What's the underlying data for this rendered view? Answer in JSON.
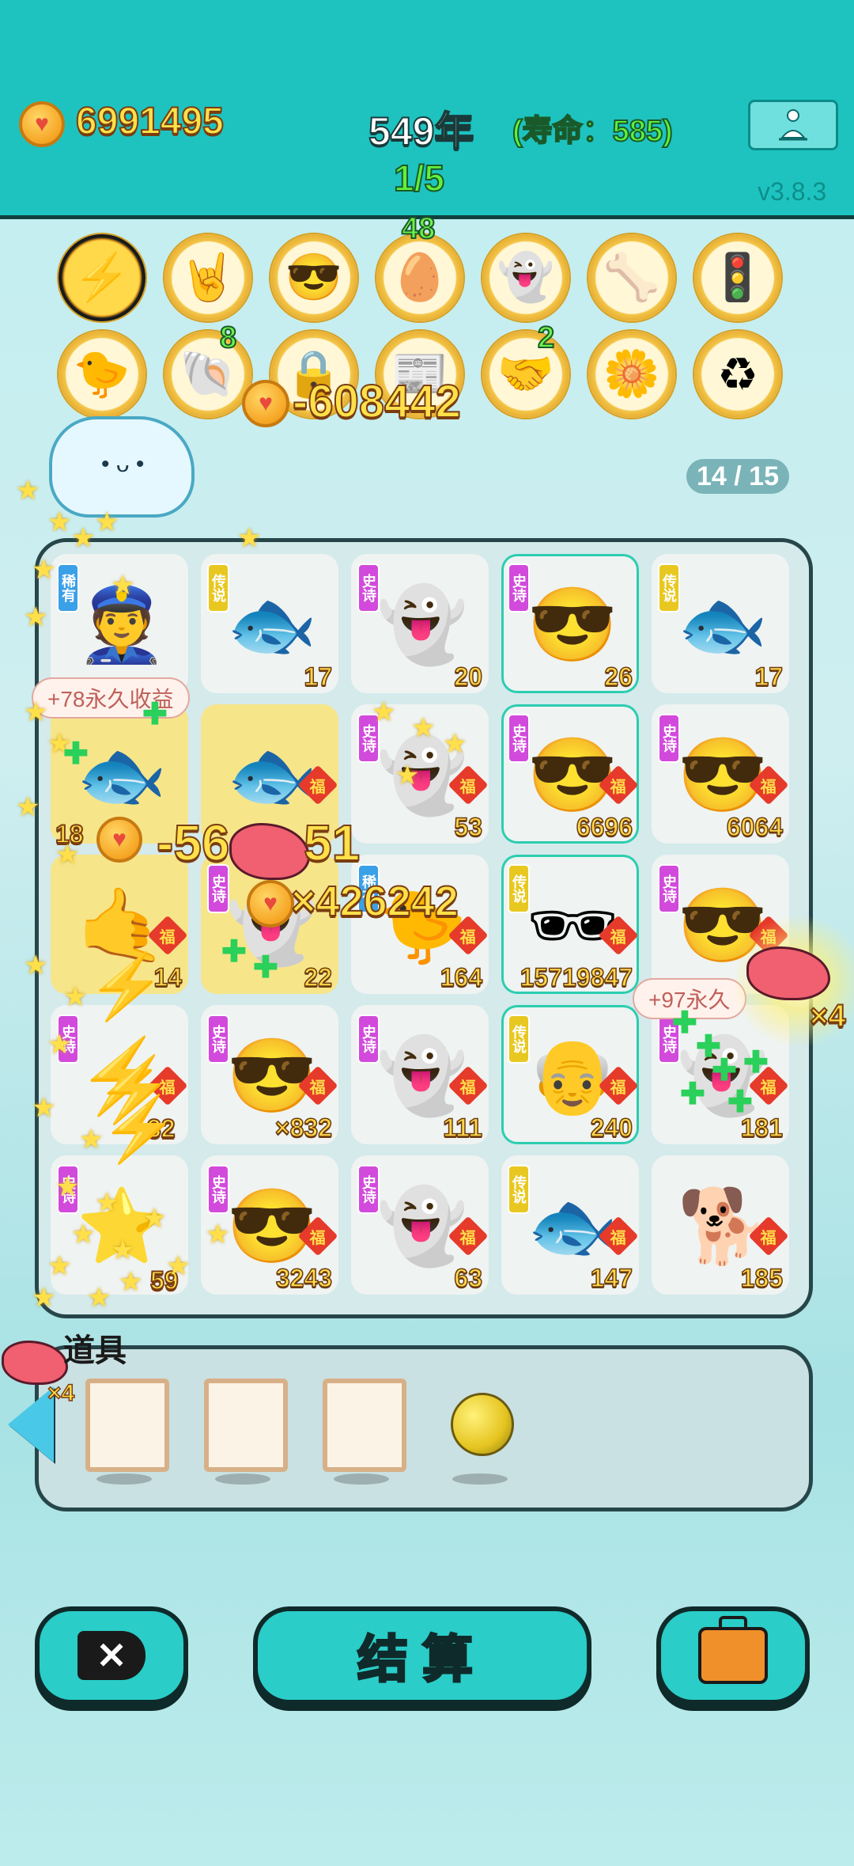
{
  "header": {
    "coins": "6991495",
    "year": "549年",
    "lifespan": "(寿命：585)",
    "round": "1/5",
    "version": "v3.8.3"
  },
  "badges": {
    "row1": [
      {
        "icon": "lightning-icon",
        "glyph": "⚡",
        "count": ""
      },
      {
        "icon": "rock-hand-icon",
        "glyph": "🤘",
        "count": ""
      },
      {
        "icon": "crowd-face-icon",
        "glyph": "😎",
        "count": ""
      },
      {
        "icon": "egg-tray-icon",
        "glyph": "🥚",
        "count": "48"
      },
      {
        "icon": "ghost-icon",
        "glyph": "👻",
        "count": ""
      },
      {
        "icon": "dog-bowl-icon",
        "glyph": "🦴",
        "count": ""
      },
      {
        "icon": "traffic-light-icon",
        "glyph": "🚦",
        "count": ""
      }
    ],
    "row2": [
      {
        "icon": "chick-icon",
        "glyph": "🐤",
        "count": ""
      },
      {
        "icon": "shell-icon",
        "glyph": "🐚",
        "count": "8"
      },
      {
        "icon": "safe-icon",
        "glyph": "🔒",
        "count": ""
      },
      {
        "icon": "time-magazine-icon",
        "glyph": "📰",
        "count": ""
      },
      {
        "icon": "handshake-icon",
        "glyph": "🤝",
        "count": "2"
      },
      {
        "icon": "flower-pot-icon",
        "glyph": "🌼",
        "count": ""
      },
      {
        "icon": "recycle-icon",
        "glyph": "♻",
        "count": ""
      }
    ]
  },
  "fx": {
    "coin_delta": "-608442",
    "multiplier": "×426242",
    "perm_gain_left": "+78永久收益",
    "perm_gain_right": "+97永久",
    "side_mult": "×4",
    "big_neg": "-56",
    "big_neg_tail": "51",
    "row3_left_val": "18",
    "row4_left_val": "32",
    "row5_left_val": "59"
  },
  "page_indicator": "14 / 15",
  "board": {
    "cells": [
      {
        "tag": "稀有",
        "tag_type": "rare",
        "glyph": "👮",
        "value": "",
        "fu": false,
        "highlight": false,
        "yellow": false,
        "name": "police-king-icon"
      },
      {
        "tag": "传说",
        "tag_type": "legend",
        "glyph": "🐟",
        "value": "17",
        "fu": false,
        "highlight": false,
        "yellow": false,
        "name": "koi-fish-icon"
      },
      {
        "tag": "史诗",
        "tag_type": "epic",
        "glyph": "👻",
        "value": "20",
        "fu": false,
        "highlight": false,
        "yellow": false,
        "name": "ghost-icon"
      },
      {
        "tag": "史诗",
        "tag_type": "epic",
        "glyph": "😎",
        "value": "26",
        "fu": false,
        "highlight": true,
        "yellow": false,
        "name": "green-hat-guy-icon"
      },
      {
        "tag": "传说",
        "tag_type": "legend",
        "glyph": "🐟",
        "value": "17",
        "fu": false,
        "highlight": false,
        "yellow": false,
        "name": "koi-fish-icon"
      },
      {
        "tag": "",
        "tag_type": "",
        "glyph": "🐟",
        "value": "",
        "fu": false,
        "highlight": false,
        "yellow": true,
        "name": "fish-crossed-icon"
      },
      {
        "tag": "",
        "tag_type": "",
        "glyph": "🐟",
        "value": "",
        "fu": true,
        "highlight": false,
        "yellow": true,
        "name": "fish-crossed-icon"
      },
      {
        "tag": "史诗",
        "tag_type": "epic",
        "glyph": "👻",
        "value": "53",
        "fu": true,
        "highlight": false,
        "yellow": false,
        "name": "ghost-icon"
      },
      {
        "tag": "史诗",
        "tag_type": "epic",
        "glyph": "😎",
        "value": "6696",
        "fu": true,
        "highlight": true,
        "yellow": false,
        "name": "green-hat-guy-icon"
      },
      {
        "tag": "史诗",
        "tag_type": "epic",
        "glyph": "😎",
        "value": "6064",
        "fu": true,
        "highlight": false,
        "yellow": false,
        "name": "green-hat-guy-icon"
      },
      {
        "tag": "",
        "tag_type": "",
        "glyph": "🤙",
        "value": "14",
        "fu": true,
        "highlight": false,
        "yellow": true,
        "name": "hand-sign-icon"
      },
      {
        "tag": "史诗",
        "tag_type": "epic",
        "glyph": "👻",
        "value": "22",
        "fu": false,
        "highlight": false,
        "yellow": true,
        "name": "ghost-icon"
      },
      {
        "tag": "稀有",
        "tag_type": "rare",
        "glyph": "🐤",
        "value": "164",
        "fu": true,
        "highlight": false,
        "yellow": false,
        "name": "chick-icon"
      },
      {
        "tag": "传说",
        "tag_type": "legend",
        "glyph": "🕶",
        "value": "15719847",
        "fu": true,
        "highlight": true,
        "yellow": false,
        "name": "sunglasses-man-icon"
      },
      {
        "tag": "史诗",
        "tag_type": "epic",
        "glyph": "😎",
        "value": "",
        "fu": true,
        "highlight": false,
        "yellow": false,
        "name": "green-hat-guy-icon"
      },
      {
        "tag": "史诗",
        "tag_type": "epic",
        "glyph": "⚡",
        "value": "",
        "fu": true,
        "highlight": false,
        "yellow": false,
        "name": "lightning-effect-icon"
      },
      {
        "tag": "史诗",
        "tag_type": "epic",
        "glyph": "😎",
        "value": "×832",
        "fu": true,
        "highlight": false,
        "yellow": false,
        "name": "green-hat-guy-icon"
      },
      {
        "tag": "史诗",
        "tag_type": "epic",
        "glyph": "👻",
        "value": "111",
        "fu": true,
        "highlight": false,
        "yellow": false,
        "name": "ghost-icon"
      },
      {
        "tag": "传说",
        "tag_type": "legend",
        "glyph": "👴",
        "value": "240",
        "fu": true,
        "highlight": true,
        "yellow": false,
        "name": "bald-grandpa-icon"
      },
      {
        "tag": "史诗",
        "tag_type": "epic",
        "glyph": "👻",
        "value": "181",
        "fu": true,
        "highlight": false,
        "yellow": false,
        "name": "ghost-icon"
      },
      {
        "tag": "史诗",
        "tag_type": "epic",
        "glyph": "⭐",
        "value": "",
        "fu": false,
        "highlight": false,
        "yellow": false,
        "name": "star-burst-icon"
      },
      {
        "tag": "史诗",
        "tag_type": "epic",
        "glyph": "😎",
        "value": "3243",
        "fu": true,
        "highlight": false,
        "yellow": false,
        "name": "green-hat-guy-icon"
      },
      {
        "tag": "史诗",
        "tag_type": "epic",
        "glyph": "👻",
        "value": "63",
        "fu": true,
        "highlight": false,
        "yellow": false,
        "name": "ghost-icon"
      },
      {
        "tag": "传说",
        "tag_type": "legend",
        "glyph": "🐟",
        "value": "147",
        "fu": true,
        "highlight": false,
        "yellow": false,
        "name": "koi-fish-icon"
      },
      {
        "tag": "",
        "tag_type": "",
        "glyph": "🐕",
        "value": "185",
        "fu": true,
        "highlight": false,
        "yellow": false,
        "name": "husky-dog-icon"
      }
    ],
    "fu_label": "福"
  },
  "props": {
    "label": "道具",
    "liver_count": "×4"
  },
  "buttons": {
    "settle": "结算"
  },
  "colors": {
    "header_bg": "#1ec3c0",
    "coin_text": "#ffe04a",
    "lifespan_green": "#5ef23a",
    "epic_tag": "#d24adc",
    "legend_tag": "#e8c820",
    "rare_tag": "#3aa0e8",
    "fu_red": "#e63a2a"
  }
}
